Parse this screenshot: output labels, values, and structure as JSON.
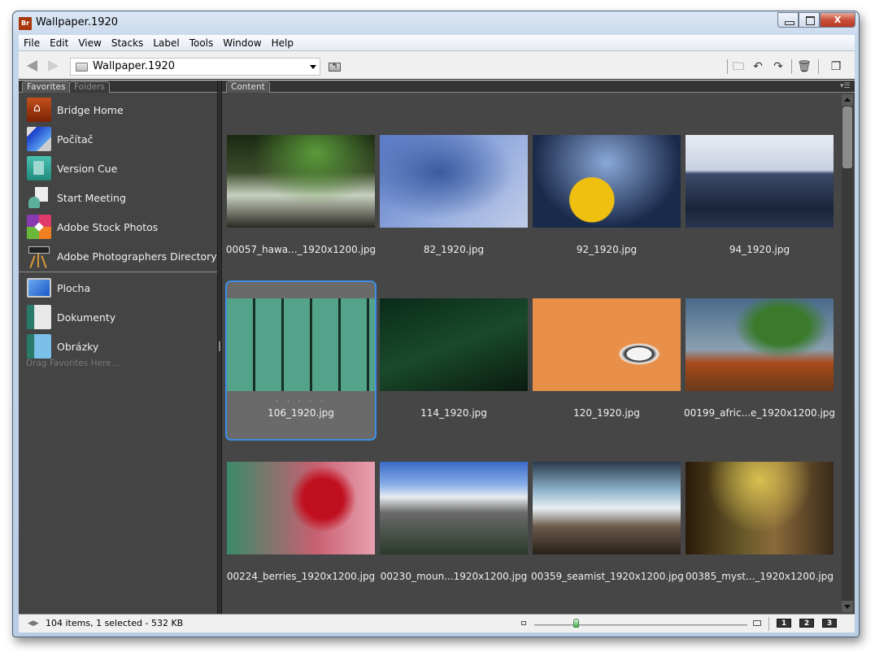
{
  "window": {
    "title": "Wallpaper.1920",
    "app_icon_label": "Br",
    "close_label": "X"
  },
  "menu": [
    "File",
    "Edit",
    "View",
    "Stacks",
    "Label",
    "Tools",
    "Window",
    "Help"
  ],
  "toolbar": {
    "path": "Wallpaper.1920",
    "icons": [
      "back-arrow-icon",
      "forward-arrow-icon",
      "folder-icon",
      "path-dropdown-icon",
      "up-folder-icon",
      "new-folder-icon",
      "rotate-left-icon",
      "rotate-right-icon",
      "trash-icon",
      "compact-mode-icon"
    ]
  },
  "left_panel": {
    "tabs": [
      {
        "label": "Favorites",
        "active": true
      },
      {
        "label": "Folders",
        "active": false
      }
    ],
    "favorites": [
      {
        "label": "Bridge Home",
        "icon": "bridge-home-icon"
      },
      {
        "label": "Počítač",
        "icon": "computer-icon"
      },
      {
        "label": "Version Cue",
        "icon": "version-cue-icon"
      },
      {
        "label": "Start Meeting",
        "icon": "start-meeting-icon"
      },
      {
        "label": "Adobe Stock Photos",
        "icon": "stock-photos-icon"
      },
      {
        "label": "Adobe Photographers Directory",
        "icon": "photographers-directory-icon"
      }
    ],
    "places": [
      {
        "label": "Plocha",
        "icon": "desktop-icon"
      },
      {
        "label": "Dokumenty",
        "icon": "documents-icon"
      },
      {
        "label": "Obrázky",
        "icon": "pictures-icon"
      }
    ],
    "drag_hint": "Drag Favorites Here..."
  },
  "content_panel": {
    "tab": "Content",
    "items": [
      {
        "name": "00057_hawa..._1920x1200.jpg",
        "selected": false
      },
      {
        "name": "82_1920.jpg",
        "selected": false
      },
      {
        "name": "92_1920.jpg",
        "selected": false
      },
      {
        "name": "94_1920.jpg",
        "selected": false
      },
      {
        "name": "106_1920.jpg",
        "selected": true,
        "rating_dots": ". . . . ."
      },
      {
        "name": "114_1920.jpg",
        "selected": false
      },
      {
        "name": "120_1920.jpg",
        "selected": false
      },
      {
        "name": "00199_afric...e_1920x1200.jpg",
        "selected": false
      },
      {
        "name": "00224_berries_1920x1200.jpg",
        "selected": false
      },
      {
        "name": "00230_moun...1920x1200.jpg",
        "selected": false
      },
      {
        "name": "00359_seamist_1920x1200.jpg",
        "selected": false
      },
      {
        "name": "00385_myst..._1920x1200.jpg",
        "selected": false
      }
    ]
  },
  "statusbar": {
    "text": "104 items, 1 selected - 532 KB",
    "thumbnail_size_fraction": 0.2,
    "view_buttons": [
      "1",
      "2",
      "3"
    ]
  },
  "colors": {
    "selection": "#3c8ee6",
    "panel_bg": "#464646"
  }
}
